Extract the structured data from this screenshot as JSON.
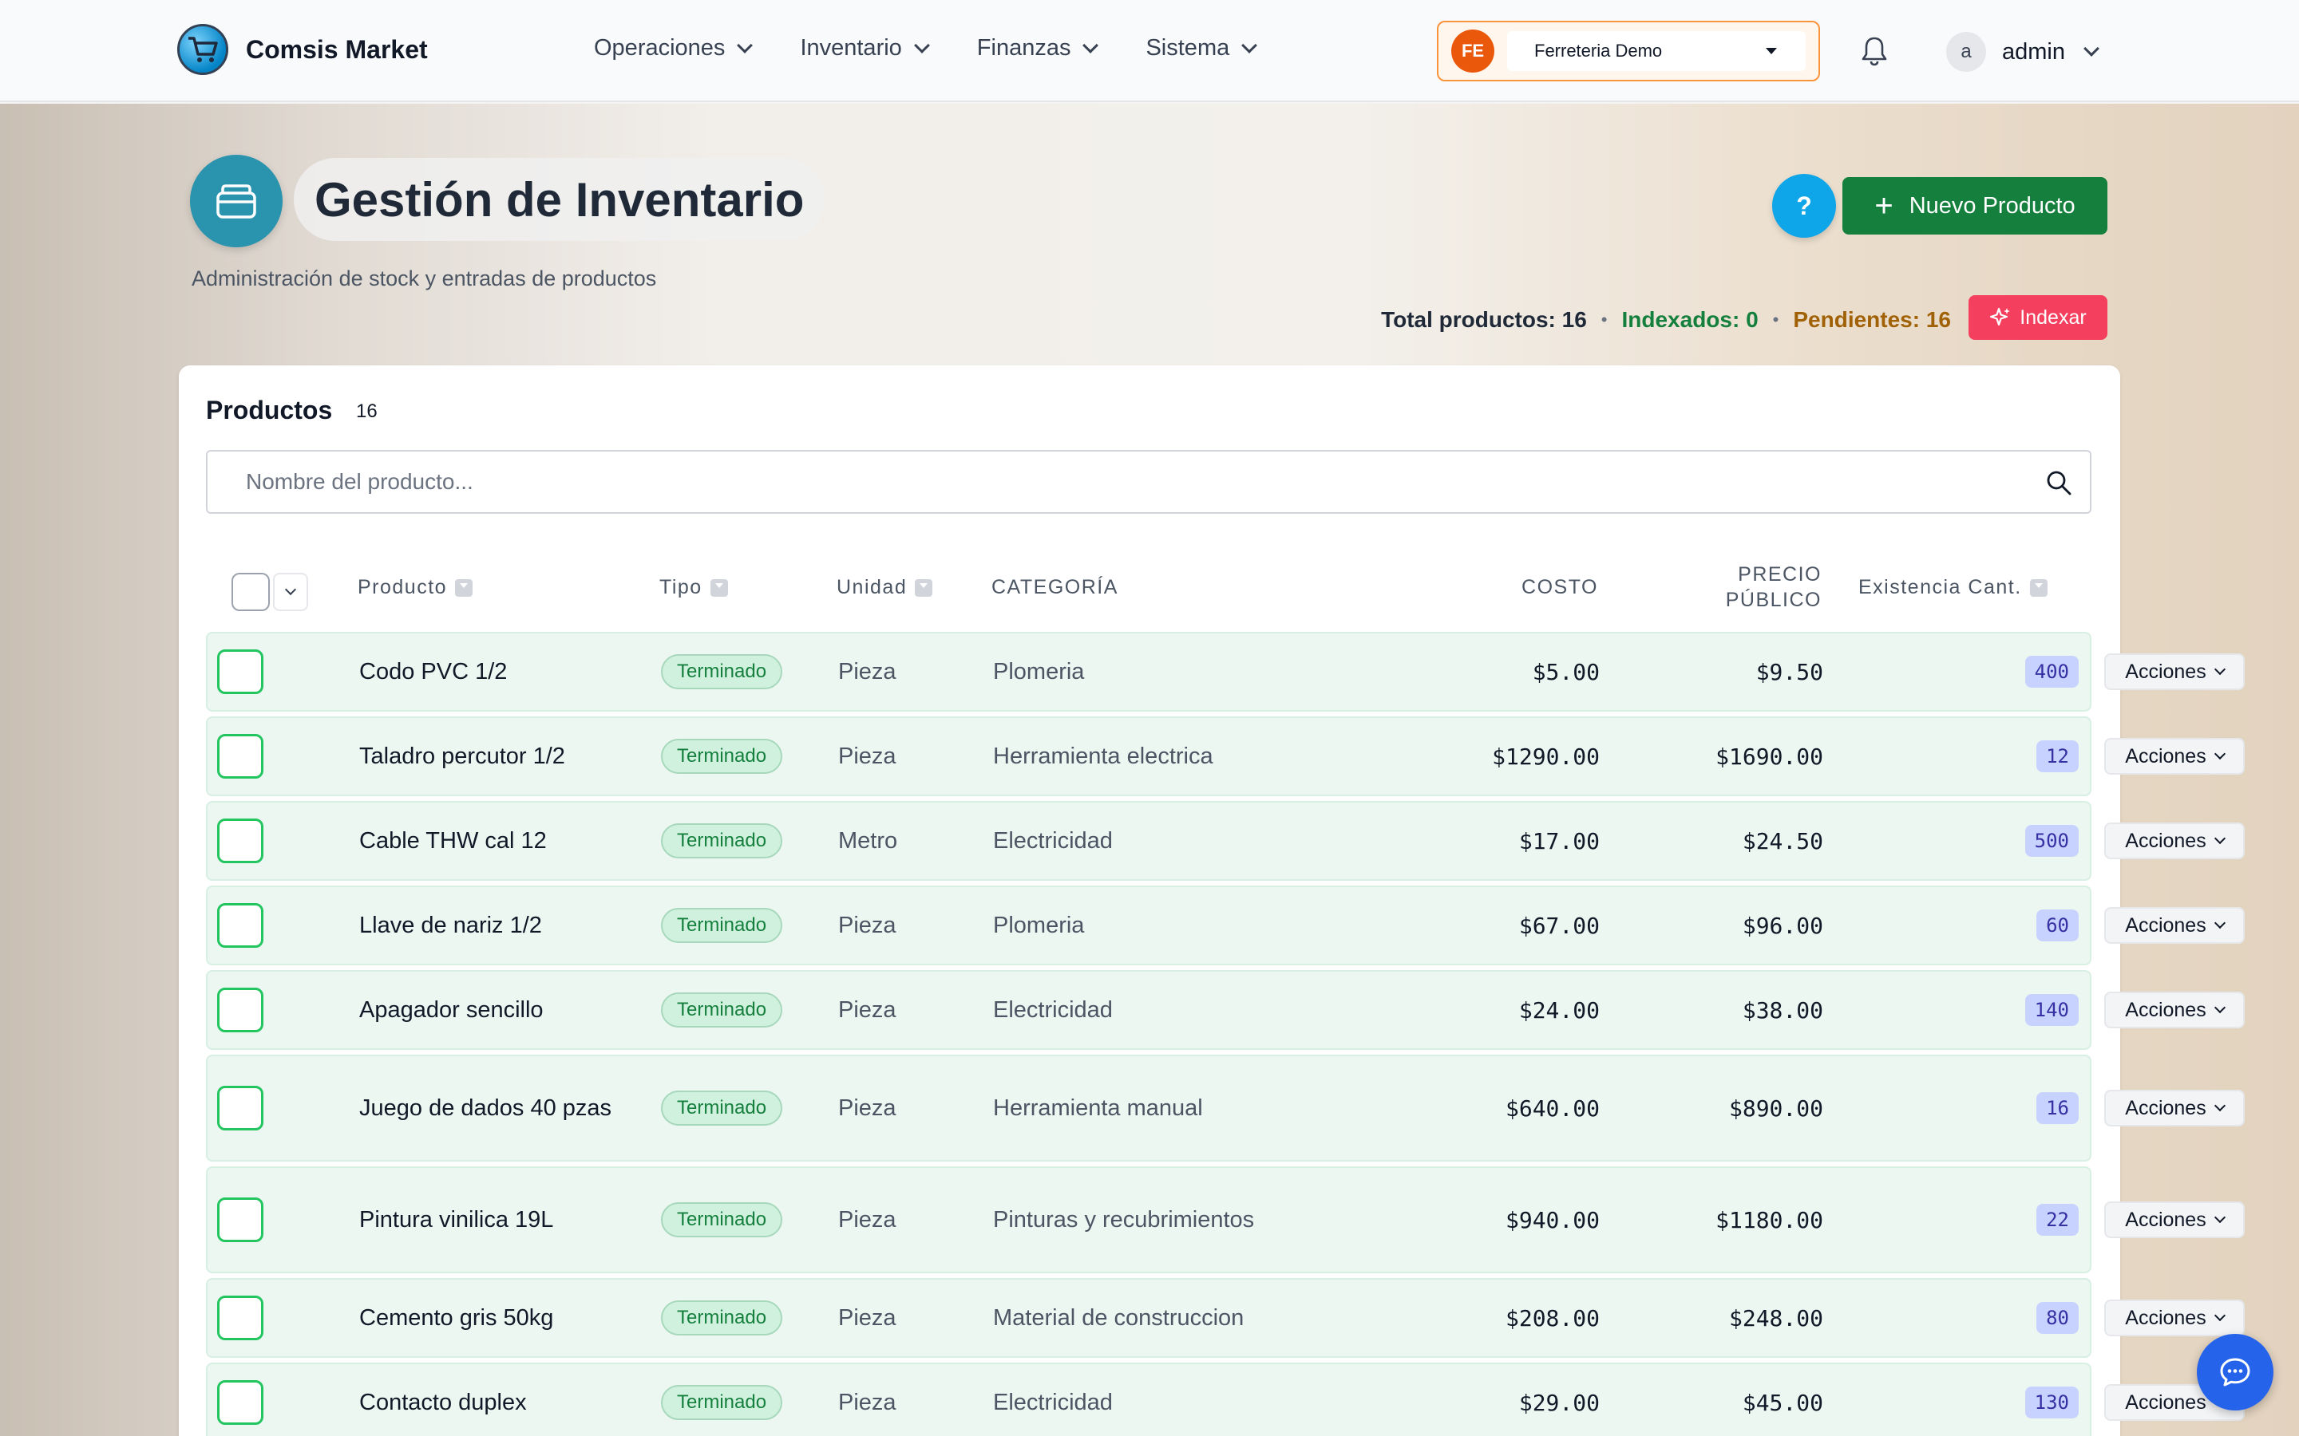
{
  "header": {
    "app_name": "Comsis Market",
    "nav": [
      {
        "label": "Operaciones"
      },
      {
        "label": "Inventario"
      },
      {
        "label": "Finanzas"
      },
      {
        "label": "Sistema"
      }
    ],
    "tenant": {
      "badge": "FE",
      "selected": "Ferreteria Demo"
    },
    "user": {
      "initial": "a",
      "name": "admin"
    }
  },
  "page": {
    "title": "Gestión de Inventario",
    "subtitle": "Administración de stock y entradas de productos",
    "help_label": "?",
    "new_product_label": "Nuevo Producto",
    "stats": {
      "total": "Total productos: 16",
      "indexed": "Indexados: 0",
      "pending": "Pendientes: 16"
    },
    "index_label": "Indexar"
  },
  "products": {
    "title": "Productos",
    "count": "16",
    "search_placeholder": "Nombre del producto...",
    "columns": {
      "product": "Producto",
      "type": "Tipo",
      "unit": "Unidad",
      "category": "CATEGORÍA",
      "cost": "COSTO",
      "price": "PRECIO PÚBLICO",
      "stock": "Existencia Cant."
    },
    "rows": [
      {
        "name": "Codo PVC 1/2",
        "type": "Terminado",
        "unit": "Pieza",
        "category": "Plomeria",
        "cost": "$5.00",
        "price": "$9.50",
        "stock": "400",
        "actions": "Acciones"
      },
      {
        "name": "Taladro percutor 1/2",
        "type": "Terminado",
        "unit": "Pieza",
        "category": "Herramienta electrica",
        "cost": "$1290.00",
        "price": "$1690.00",
        "stock": "12",
        "actions": "Acciones"
      },
      {
        "name": "Cable THW cal 12",
        "type": "Terminado",
        "unit": "Metro",
        "category": "Electricidad",
        "cost": "$17.00",
        "price": "$24.50",
        "stock": "500",
        "actions": "Acciones"
      },
      {
        "name": "Llave de nariz 1/2",
        "type": "Terminado",
        "unit": "Pieza",
        "category": "Plomeria",
        "cost": "$67.00",
        "price": "$96.00",
        "stock": "60",
        "actions": "Acciones"
      },
      {
        "name": "Apagador sencillo",
        "type": "Terminado",
        "unit": "Pieza",
        "category": "Electricidad",
        "cost": "$24.00",
        "price": "$38.00",
        "stock": "140",
        "actions": "Acciones"
      },
      {
        "name": "Juego de dados 40 pzas",
        "type": "Terminado",
        "unit": "Pieza",
        "category": "Herramienta manual",
        "cost": "$640.00",
        "price": "$890.00",
        "stock": "16",
        "actions": "Acciones"
      },
      {
        "name": "Pintura vinilica 19L",
        "type": "Terminado",
        "unit": "Pieza",
        "category": "Pinturas y recubrimientos",
        "cost": "$940.00",
        "price": "$1180.00",
        "stock": "22",
        "actions": "Acciones"
      },
      {
        "name": "Cemento gris 50kg",
        "type": "Terminado",
        "unit": "Pieza",
        "category": "Material de construccion",
        "cost": "$208.00",
        "price": "$248.00",
        "stock": "80",
        "actions": "Acciones"
      },
      {
        "name": "Contacto duplex",
        "type": "Terminado",
        "unit": "Pieza",
        "category": "Electricidad",
        "cost": "$29.00",
        "price": "$45.00",
        "stock": "130",
        "actions": "Acciones"
      }
    ]
  },
  "colors": {
    "primary_green": "#15803d",
    "help_blue": "#0ea5e9",
    "index_pink": "#f43f5e",
    "tenant_orange": "#ea580c"
  },
  "icons": [
    "cart-logo-icon",
    "chevron-down-icon",
    "bell-icon",
    "inventory-icon",
    "plus-icon",
    "sparkles-icon",
    "search-icon",
    "sort-icon",
    "chat-icon"
  ]
}
